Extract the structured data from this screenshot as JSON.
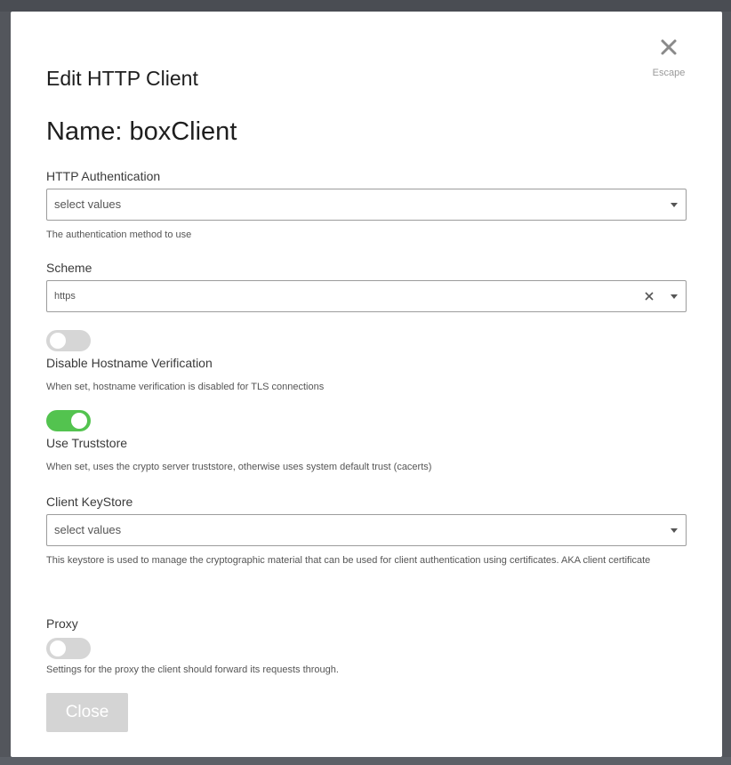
{
  "dialog": {
    "title": "Edit HTTP Client",
    "escape_label": "Escape",
    "name_heading": "Name: boxClient"
  },
  "http_authentication": {
    "label": "HTTP Authentication",
    "placeholder": "select values",
    "help": "The authentication method to use"
  },
  "scheme": {
    "label": "Scheme",
    "value": "https"
  },
  "disable_hostname_verification": {
    "label": "Disable Hostname Verification",
    "enabled": false,
    "help": "When set, hostname verification is disabled for TLS connections"
  },
  "use_truststore": {
    "label": "Use Truststore",
    "enabled": true,
    "help": "When set, uses the crypto server truststore, otherwise uses system default trust (cacerts)"
  },
  "client_keystore": {
    "label": "Client KeyStore",
    "placeholder": "select values",
    "help": "This keystore is used to manage the cryptographic material that can be used for client authentication using certificates. AKA client certificate"
  },
  "proxy": {
    "label": "Proxy",
    "enabled": false,
    "help": "Settings for the proxy the client should forward its requests through."
  },
  "footer": {
    "close_label": "Close"
  },
  "colors": {
    "toggle_on": "#53c34f",
    "toggle_off": "#d6d6d6",
    "close_button_bg": "#d4d4d4"
  },
  "icons": {
    "dialog_close": "close-icon",
    "dropdown": "chevron-down-icon",
    "clear": "clear-icon"
  }
}
